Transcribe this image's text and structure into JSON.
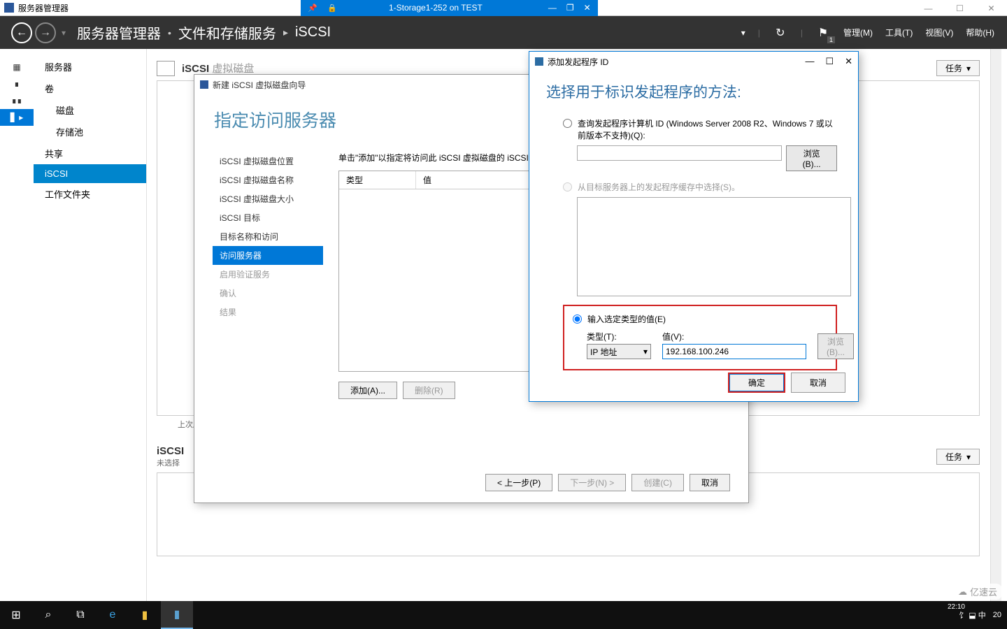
{
  "vm": {
    "app_title": "服务器管理器",
    "center_title": "1-Storage1-252 on TEST"
  },
  "outer_controls": {
    "min": "—",
    "max": "☐",
    "close": "✕"
  },
  "sm": {
    "bc1": "服务器管理器",
    "bc2": "文件和存储服务",
    "bc3": "iSCSI",
    "menu_manage": "管理(M)",
    "menu_tools": "工具(T)",
    "menu_view": "视图(V)",
    "menu_help": "帮助(H)",
    "flag_badge": "1"
  },
  "tree": {
    "servers": "服务器",
    "volumes": "卷",
    "disks": "磁盘",
    "pools": "存储池",
    "shares": "共享",
    "iscsi": "iSCSI",
    "work": "工作文件夹"
  },
  "sections": {
    "s1_title": "iSCSI",
    "s1_sub": "虚拟磁盘",
    "s1_last": "上次刷",
    "s2_title": "iSCSI",
    "s2_sub": "未选择",
    "tasks": "任务"
  },
  "wizard": {
    "title": "新建 iSCSI 虚拟磁盘向导",
    "header": "指定访问服务器",
    "steps": {
      "loc": "iSCSI 虚拟磁盘位置",
      "name": "iSCSI 虚拟磁盘名称",
      "size": "iSCSI 虚拟磁盘大小",
      "target": "iSCSI 目标",
      "tname": "目标名称和访问",
      "access": "访问服务器",
      "auth": "启用验证服务",
      "confirm": "确认",
      "result": "结果"
    },
    "hint": "单击\"添加\"以指定将访问此 iSCSI 虚拟磁盘的 iSCSI 发起",
    "th_type": "类型",
    "th_value": "值",
    "btn_add": "添加(A)...",
    "btn_remove": "删除(R)",
    "btn_prev": "< 上一步(P)",
    "btn_next": "下一步(N) >",
    "btn_create": "创建(C)",
    "btn_cancel": "取消"
  },
  "modal": {
    "title": "添加发起程序 ID",
    "header": "选择用于标识发起程序的方法:",
    "opt1": "查询发起程序计算机 ID (Windows Server 2008 R2、Windows 7 或以前版本不支持)(Q):",
    "browse": "浏览(B)...",
    "opt2": "从目标服务器上的发起程序缓存中选择(S)。",
    "opt3": "输入选定类型的值(E)",
    "type_label": "类型(T):",
    "type_value": "IP 地址",
    "value_label": "值(V):",
    "value_value": "192.168.100.246",
    "ok": "确定",
    "cancel": "取消"
  },
  "taskbar": {
    "tray": "饣 ⬓ 中",
    "time_partial": "20",
    "clock": "22:10"
  },
  "watermark": "亿速云"
}
